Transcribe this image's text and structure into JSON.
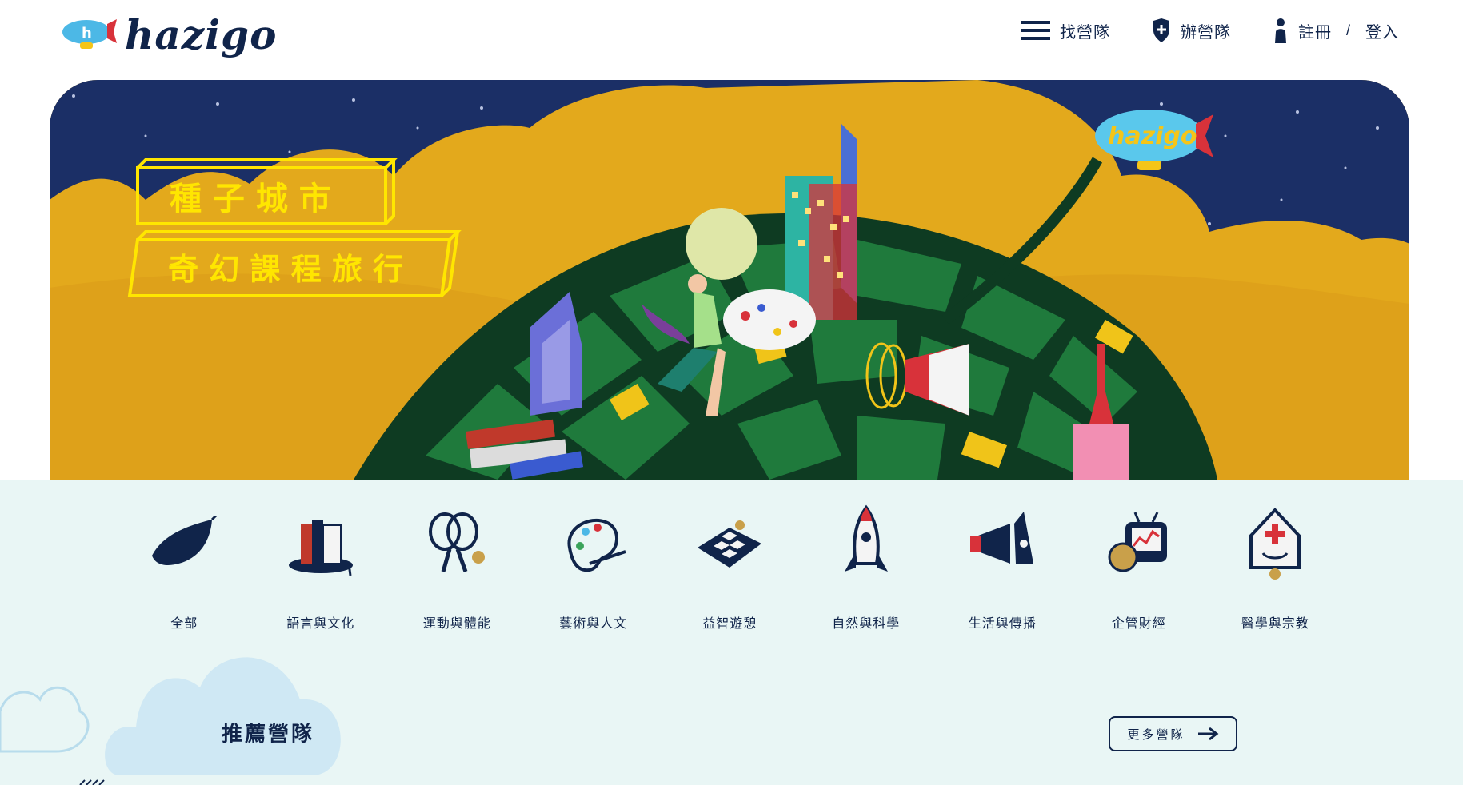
{
  "brand": {
    "logo_text": "hazigo"
  },
  "nav": {
    "find_camp": "找營隊",
    "host_camp": "辦營隊",
    "register": "註冊",
    "separator": "/",
    "login": "登入"
  },
  "hero": {
    "badge_text": "hazigo",
    "sign_line1": "種 子 城 市",
    "sign_line2": "奇 幻 課 程 旅 行"
  },
  "categories": [
    {
      "label": "全部",
      "icon": "leaf-icon"
    },
    {
      "label": "語言與文化",
      "icon": "books-icon"
    },
    {
      "label": "運動與體能",
      "icon": "rackets-icon"
    },
    {
      "label": "藝術與人文",
      "icon": "palette-icon"
    },
    {
      "label": "益智遊憩",
      "icon": "chessboard-icon"
    },
    {
      "label": "自然與科學",
      "icon": "rocket-icon"
    },
    {
      "label": "生活與傳播",
      "icon": "megaphone-icon"
    },
    {
      "label": "企管財經",
      "icon": "tv-coin-icon"
    },
    {
      "label": "醫學與宗教",
      "icon": "hospital-icon"
    }
  ],
  "recommend": {
    "title": "推薦營隊",
    "more_button": "更多營隊"
  },
  "colors": {
    "navy": "#10244a",
    "night_sky": "#1b2f66",
    "gold": "#e3a91c",
    "leaf_green": "#1f7a3c",
    "section_bg": "#e9f6f5",
    "cloud_blue": "#cfe8f4",
    "neon_yellow": "#ffe600"
  }
}
